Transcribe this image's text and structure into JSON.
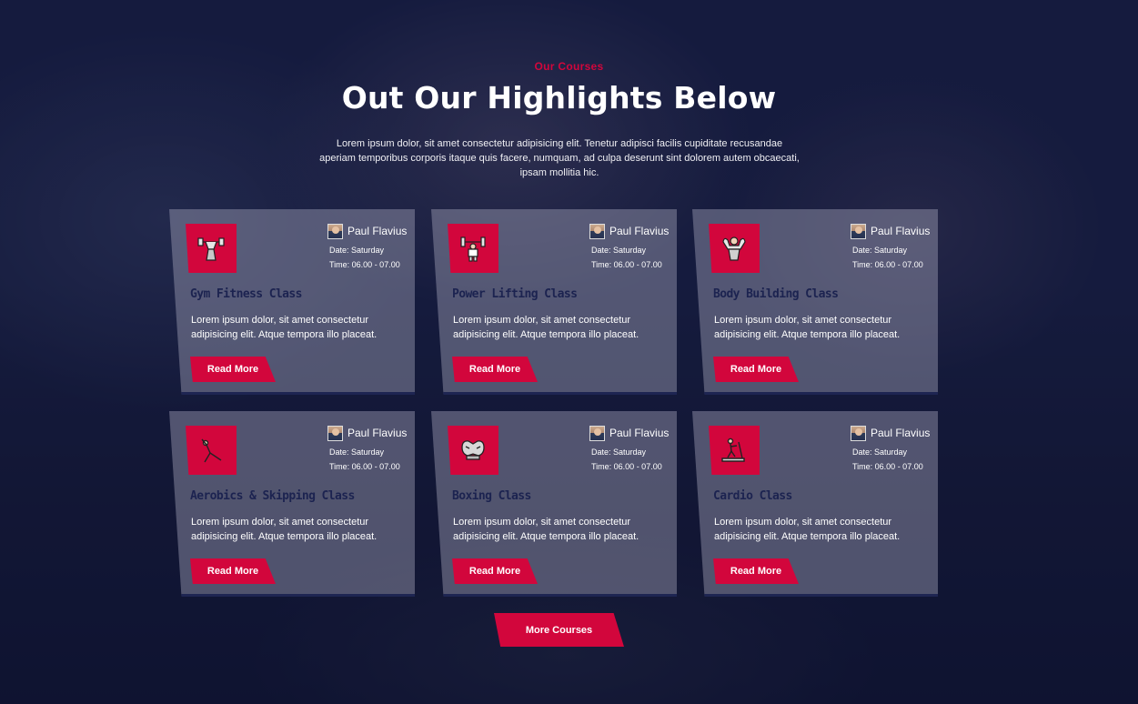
{
  "section": {
    "eyebrow": "Our Courses",
    "title": "Out Our Highlights Below",
    "description": "Lorem ipsum dolor, sit amet consectetur adipisicing elit. Tenetur adipisci facilis cupiditate recusandae aperiam temporibus corporis itaque quis facere, numquam, ad culpa deserunt sint dolorem autem obcaecati, ipsam mollitia hic."
  },
  "colors": {
    "accent": "#d2063c",
    "card_title": "#1c2350",
    "overlay": "#141a3a"
  },
  "courses": [
    {
      "name": "Gym Fitness Class",
      "icon": "weightlifter-icon",
      "trainer": "Paul Flavius",
      "date": "Date: Saturday",
      "time": "Time: 06.00 - 07.00",
      "text": "Lorem ipsum dolor, sit amet consectetur adipisicing elit. Atque tempora illo placeat.",
      "button": "Read More"
    },
    {
      "name": "Power Lifting Class",
      "icon": "barbell-lifter-icon",
      "trainer": "Paul Flavius",
      "date": "Date: Saturday",
      "time": "Time: 06.00 - 07.00",
      "text": "Lorem ipsum dolor, sit amet consectetur adipisicing elit. Atque tempora illo placeat.",
      "button": "Read More"
    },
    {
      "name": "Body Building Class",
      "icon": "bodybuilder-icon",
      "trainer": "Paul Flavius",
      "date": "Date: Saturday",
      "time": "Time: 06.00 - 07.00",
      "text": "Lorem ipsum dolor, sit amet consectetur adipisicing elit. Atque tempora illo placeat.",
      "button": "Read More"
    },
    {
      "name": "Aerobics & Skipping Class",
      "icon": "yoga-pose-icon",
      "trainer": "Paul Flavius",
      "date": "Date: Saturday",
      "time": "Time: 06.00 - 07.00",
      "text": "Lorem ipsum dolor, sit amet consectetur adipisicing elit. Atque tempora illo placeat.",
      "button": "Read More"
    },
    {
      "name": "Boxing Class",
      "icon": "boxing-gloves-icon",
      "trainer": "Paul Flavius",
      "date": "Date: Saturday",
      "time": "Time: 06.00 - 07.00",
      "text": "Lorem ipsum dolor, sit amet consectetur adipisicing elit. Atque tempora illo placeat.",
      "button": "Read More"
    },
    {
      "name": "Cardio Class",
      "icon": "treadmill-icon",
      "trainer": "Paul Flavius",
      "date": "Date: Saturday",
      "time": "Time: 06.00 - 07.00",
      "text": "Lorem ipsum dolor, sit amet consectetur adipisicing elit. Atque tempora illo placeat.",
      "button": "Read More"
    }
  ],
  "more_button": "More Courses"
}
